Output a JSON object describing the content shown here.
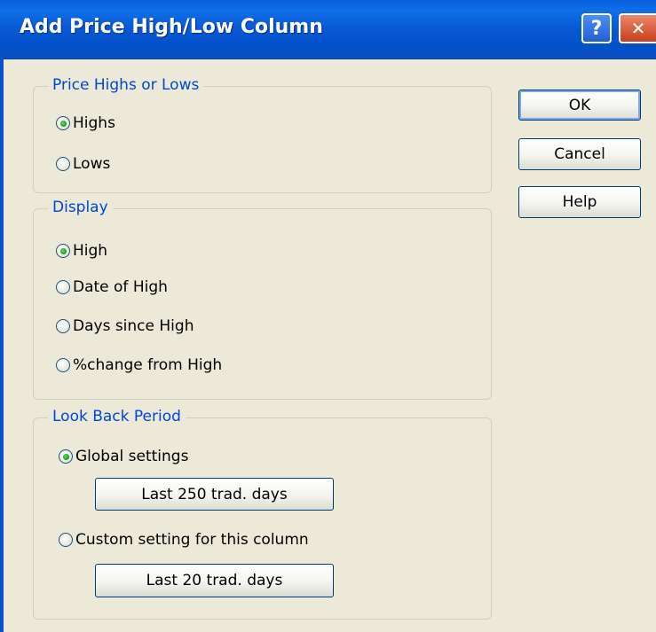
{
  "window": {
    "title": "Add Price High/Low Column"
  },
  "titlebar": {
    "help_glyph": "?",
    "close_glyph": "✕"
  },
  "groups": {
    "price": {
      "legend": "Price Highs or Lows",
      "options": [
        {
          "label": "Highs",
          "checked": true
        },
        {
          "label": "Lows",
          "checked": false
        }
      ]
    },
    "display": {
      "legend": "Display",
      "options": [
        {
          "label": "High",
          "checked": true
        },
        {
          "label": "Date of High",
          "checked": false
        },
        {
          "label": "Days since High",
          "checked": false
        },
        {
          "label": "%change from High",
          "checked": false
        }
      ]
    },
    "lookback": {
      "legend": "Look Back Period",
      "options": [
        {
          "label": "Global settings",
          "checked": true
        },
        {
          "label": "Custom setting for this column",
          "checked": false
        }
      ],
      "global_button": "Last 250 trad. days",
      "custom_button": "Last 20 trad. days"
    }
  },
  "buttons": {
    "ok": "OK",
    "cancel": "Cancel",
    "help": "Help"
  },
  "colors": {
    "title_bar": "#0a5fdb",
    "group_legend": "#0046d5",
    "dialog_bg": "#ece9d8"
  }
}
